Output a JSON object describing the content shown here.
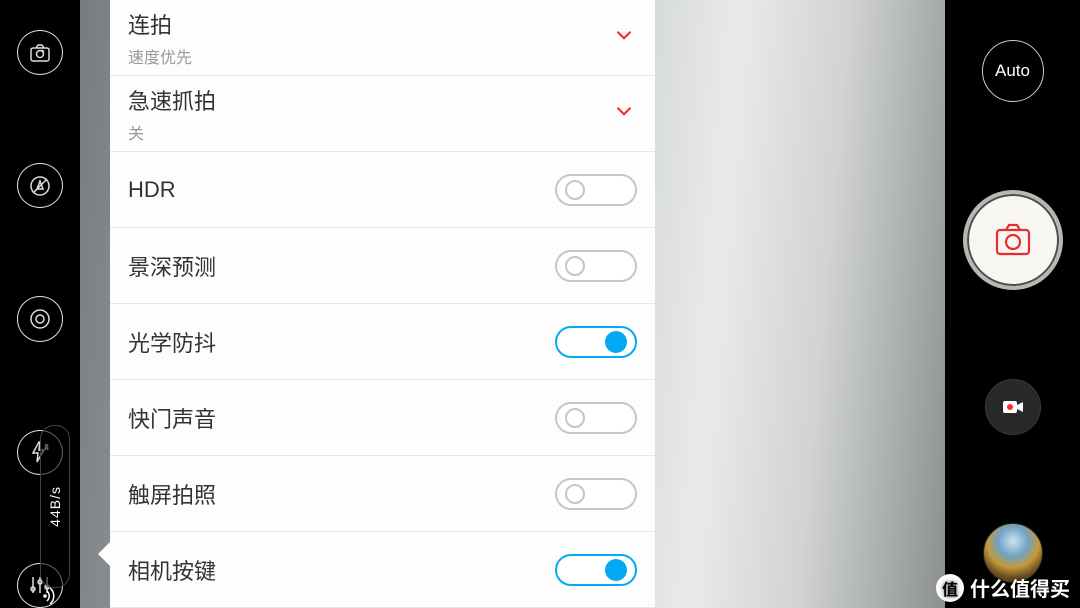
{
  "right_bar": {
    "auto_label": "Auto"
  },
  "traffic": {
    "rate": "44B/s"
  },
  "settings": [
    {
      "title": "连拍",
      "sub": "速度优先",
      "kind": "select"
    },
    {
      "title": "急速抓拍",
      "sub": "关",
      "kind": "select"
    },
    {
      "title": "HDR",
      "sub": "",
      "kind": "toggle",
      "on": false
    },
    {
      "title": "景深预测",
      "sub": "",
      "kind": "toggle",
      "on": false
    },
    {
      "title": "光学防抖",
      "sub": "",
      "kind": "toggle",
      "on": true
    },
    {
      "title": "快门声音",
      "sub": "",
      "kind": "toggle",
      "on": false
    },
    {
      "title": "触屏拍照",
      "sub": "",
      "kind": "toggle",
      "on": false
    },
    {
      "title": "相机按键",
      "sub": "",
      "kind": "toggle",
      "on": true
    }
  ],
  "watermark": {
    "badge": "值",
    "text": "什么值得买"
  }
}
